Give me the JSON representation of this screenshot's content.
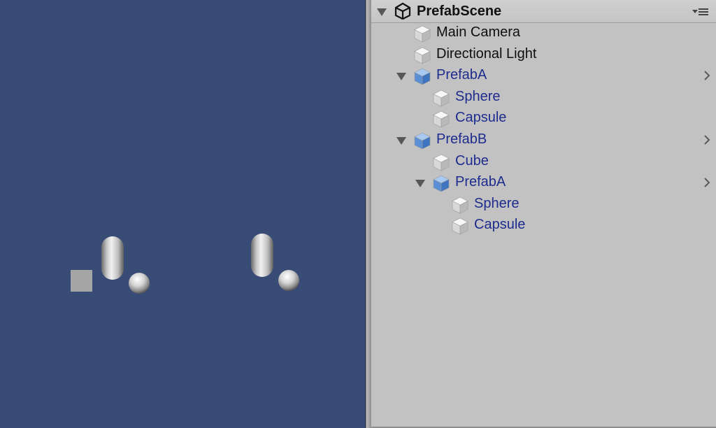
{
  "colors": {
    "scene_background": "#384c76",
    "panel_background": "#c2c2c2",
    "plain_text": "#0f0f0f",
    "prefab_text": "#1e2c8e",
    "prefab_icon": "#5f96dc",
    "gameobject_icon": "#e6e6e6"
  },
  "hierarchy": {
    "scene_title": "PrefabScene",
    "menu_icon": "context-menu-icon",
    "rows": [
      {
        "label": "Main Camera",
        "depth": 0,
        "kind": "gameobject",
        "expanded": null
      },
      {
        "label": "Directional Light",
        "depth": 0,
        "kind": "gameobject",
        "expanded": null
      },
      {
        "label": "PrefabA",
        "depth": 0,
        "kind": "prefab",
        "expanded": true
      },
      {
        "label": "Sphere",
        "depth": 1,
        "kind": "prefab-child",
        "expanded": null
      },
      {
        "label": "Capsule",
        "depth": 1,
        "kind": "prefab-child",
        "expanded": null
      },
      {
        "label": "PrefabB",
        "depth": 0,
        "kind": "prefab",
        "expanded": true
      },
      {
        "label": "Cube",
        "depth": 1,
        "kind": "prefab-child",
        "expanded": null
      },
      {
        "label": "PrefabA",
        "depth": 1,
        "kind": "prefab",
        "expanded": true
      },
      {
        "label": "Sphere",
        "depth": 2,
        "kind": "prefab-child",
        "expanded": null
      },
      {
        "label": "Capsule",
        "depth": 2,
        "kind": "prefab-child",
        "expanded": null
      }
    ]
  }
}
